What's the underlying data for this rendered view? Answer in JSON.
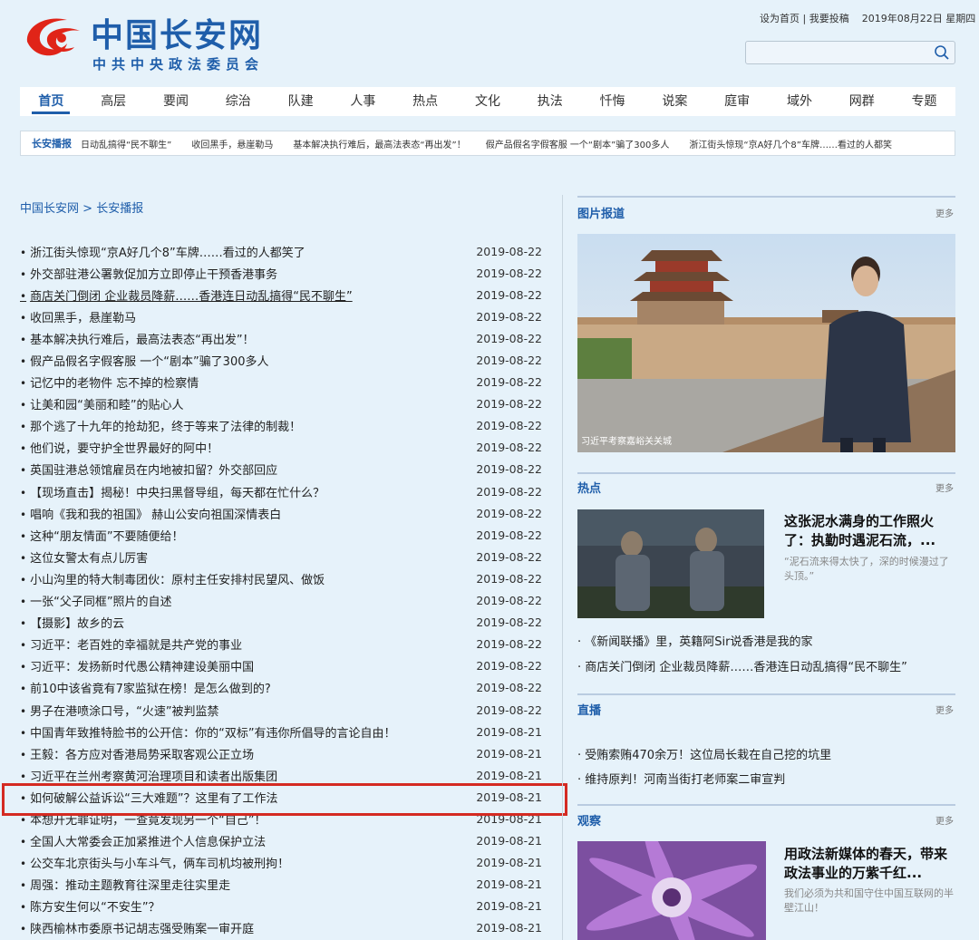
{
  "header": {
    "logo_title": "中国长安网",
    "logo_subtitle": "中共中央政法委员会",
    "set_home": "设为首页",
    "submit": "我要投稿",
    "date": "2019年08月22日 星期四",
    "search_placeholder": ""
  },
  "nav": [
    "首页",
    "高层",
    "要闻",
    "综治",
    "队建",
    "人事",
    "热点",
    "文化",
    "执法",
    "忏悔",
    "说案",
    "庭审",
    "域外",
    "网群",
    "专题"
  ],
  "ticker": {
    "label": "长安播报",
    "items": [
      "日动乱搞得“民不聊生”",
      "收回黑手，悬崖勒马",
      "基本解决执行难后，最高法表态“再出发”！",
      "假产品假名字假客服 一个“剧本”骗了300多人",
      "浙江街头惊现“京A好几个8”车牌……看过的人都笑"
    ]
  },
  "breadcrumb": {
    "home": "中国长安网",
    "sep": ">",
    "current": "长安播报"
  },
  "news": [
    {
      "title": "浙江街头惊现“京A好几个8”车牌……看过的人都笑了",
      "date": "2019-08-22"
    },
    {
      "title": "外交部驻港公署敦促加方立即停止干预香港事务",
      "date": "2019-08-22"
    },
    {
      "title": "商店关门倒闭 企业裁员降薪……香港连日动乱搞得“民不聊生”",
      "date": "2019-08-22"
    },
    {
      "title": "收回黑手，悬崖勒马",
      "date": "2019-08-22"
    },
    {
      "title": "基本解决执行难后，最高法表态“再出发”！",
      "date": "2019-08-22"
    },
    {
      "title": "假产品假名字假客服 一个“剧本”骗了300多人",
      "date": "2019-08-22"
    },
    {
      "title": "记忆中的老物件 忘不掉的检察情",
      "date": "2019-08-22"
    },
    {
      "title": "让美和园“美丽和睦”的贴心人",
      "date": "2019-08-22"
    },
    {
      "title": "那个逃了十九年的抢劫犯，终于等来了法律的制裁！",
      "date": "2019-08-22"
    },
    {
      "title": "他们说，要守护全世界最好的阿中！",
      "date": "2019-08-22"
    },
    {
      "title": "英国驻港总领馆雇员在内地被扣留？外交部回应",
      "date": "2019-08-22"
    },
    {
      "title": "【现场直击】揭秘！中央扫黑督导组，每天都在忙什么？",
      "date": "2019-08-22"
    },
    {
      "title": "唱响《我和我的祖国》 赫山公安向祖国深情表白",
      "date": "2019-08-22"
    },
    {
      "title": "这种“朋友情面”不要随便给！",
      "date": "2019-08-22"
    },
    {
      "title": "这位女警太有点儿厉害",
      "date": "2019-08-22"
    },
    {
      "title": "小山沟里的特大制毒团伙：原村主任安排村民望风、做饭",
      "date": "2019-08-22"
    },
    {
      "title": "一张“父子同框”照片的自述",
      "date": "2019-08-22"
    },
    {
      "title": "【摄影】故乡的云",
      "date": "2019-08-22"
    },
    {
      "title": "习近平：老百姓的幸福就是共产党的事业",
      "date": "2019-08-22"
    },
    {
      "title": "习近平：发扬新时代愚公精神建设美丽中国",
      "date": "2019-08-22"
    },
    {
      "title": "前10中该省竟有7家监狱在榜！是怎么做到的?",
      "date": "2019-08-22"
    },
    {
      "title": "男子在港喷涂口号，“火速”被判监禁",
      "date": "2019-08-22"
    },
    {
      "title": "中国青年致推特脸书的公开信：你的“双标”有违你所倡导的言论自由！",
      "date": "2019-08-21"
    },
    {
      "title": "王毅：各方应对香港局势采取客观公正立场",
      "date": "2019-08-21"
    },
    {
      "title": "习近平在兰州考察黄河治理项目和读者出版集团",
      "date": "2019-08-21"
    },
    {
      "title": "如何破解公益诉讼“三大难题”？这里有了工作法",
      "date": "2019-08-21"
    },
    {
      "title": "本想开无罪证明，一查竟发现另一个“自己”！",
      "date": "2019-08-21"
    },
    {
      "title": "全国人大常委会正加紧推进个人信息保护立法",
      "date": "2019-08-21"
    },
    {
      "title": "公交车北京街头与小车斗气，俩车司机均被刑拘！",
      "date": "2019-08-21"
    },
    {
      "title": "周强：推动主题教育往深里走往实里走",
      "date": "2019-08-21"
    },
    {
      "title": "陈方安生何以“不安生”？",
      "date": "2019-08-21"
    },
    {
      "title": "陕西榆林市委原书记胡志强受贿案一审开庭",
      "date": "2019-08-21"
    }
  ],
  "sidebar": {
    "more": "更多",
    "photo": {
      "title": "图片报道",
      "caption": "习近平考察嘉峪关关城"
    },
    "hot": {
      "title": "热点",
      "headline": "这张泥水满身的工作照火了：执勤时遇泥石流，...",
      "desc": "“泥石流来得太快了，深的时候漫过了头顶。”",
      "links": [
        "· 《新闻联播》里，英籍阿Sir说香港是我的家",
        "· 商店关门倒闭 企业裁员降薪……香港连日动乱搞得“民不聊生”"
      ]
    },
    "live": {
      "title": "直播",
      "links": [
        "· 受贿索贿470余万！这位局长栽在自己挖的坑里",
        "· 维持原判！河南当街打老师案二审宣判"
      ]
    },
    "observe": {
      "title": "观察",
      "headline": "用政法新媒体的春天，带来政法事业的万紫千红...",
      "desc": "我们必须为共和国守住中国互联网的半壁江山！"
    }
  }
}
